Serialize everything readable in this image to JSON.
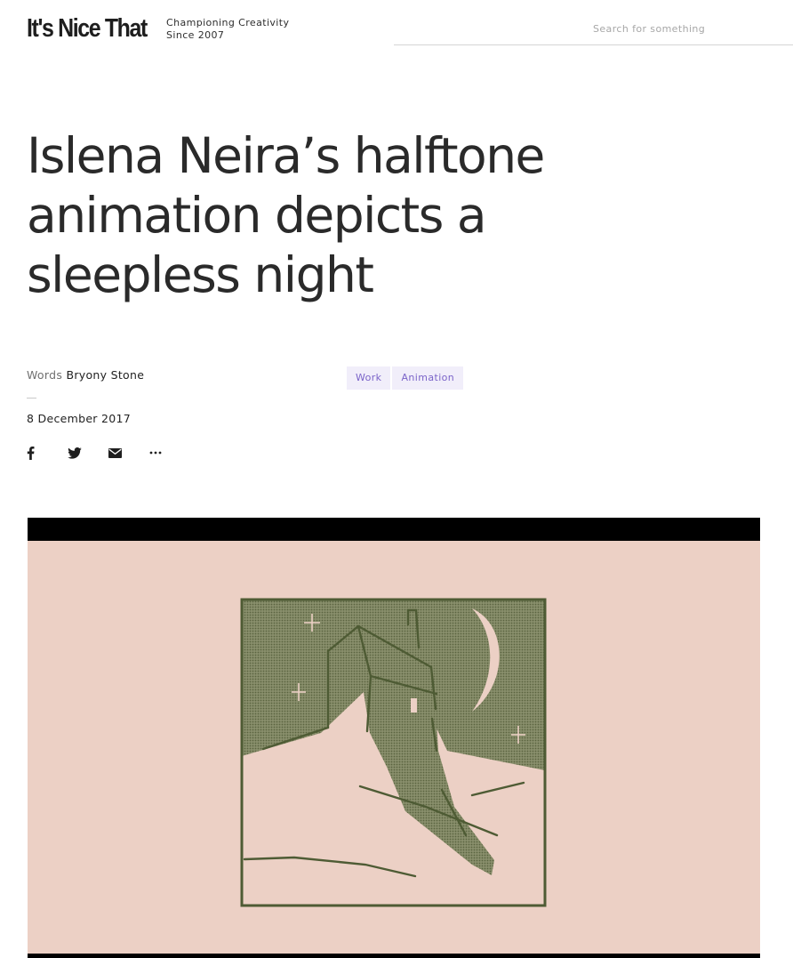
{
  "header": {
    "logo": "It's Nice That",
    "tagline_line1": "Championing Creativity",
    "tagline_line2": "Since 2007",
    "search_placeholder": "Search for something"
  },
  "article": {
    "title": "Islena Neira’s halftone animation depicts a sleepless night",
    "byline_label": "Words",
    "author": "Bryony Stone",
    "date": "8 December 2017",
    "tags": [
      "Work",
      "Animation"
    ]
  },
  "share": {
    "icons": [
      "facebook-icon",
      "twitter-icon",
      "email-icon",
      "more-icon"
    ],
    "more_label": "..."
  },
  "media": {
    "description_colors": {
      "background": "#ecd0c5",
      "ink": "#4e5b34",
      "letterbox": "#000000"
    }
  }
}
